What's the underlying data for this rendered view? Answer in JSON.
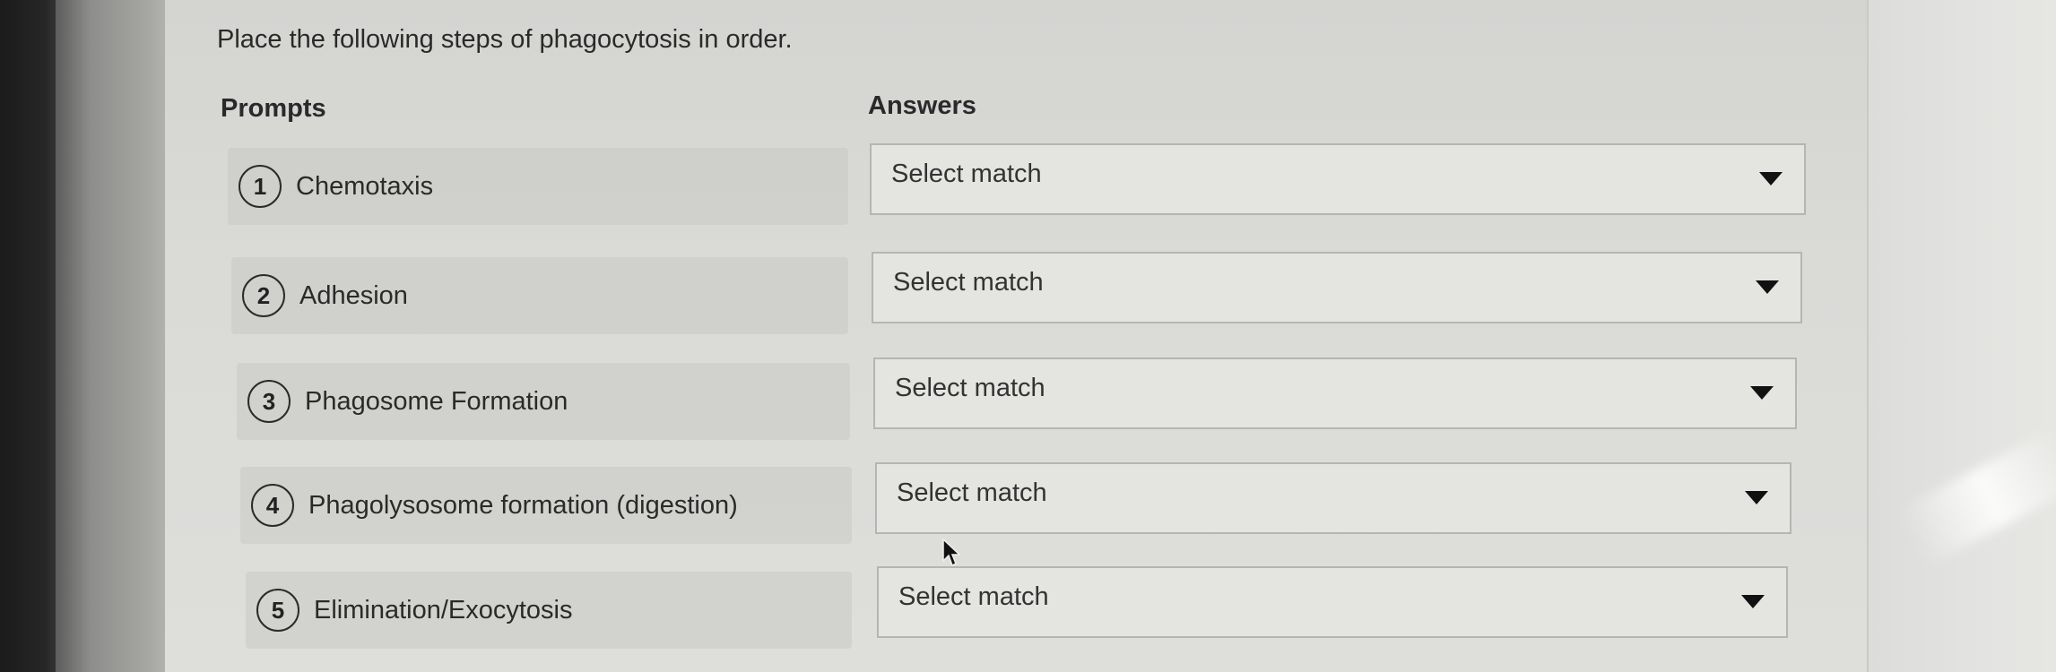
{
  "question": {
    "title": "Place the following steps of phagocytosis in order."
  },
  "columns": {
    "prompts_label": "Prompts",
    "answers_label": "Answers"
  },
  "prompts": [
    {
      "number": "1",
      "text": "Chemotaxis"
    },
    {
      "number": "2",
      "text": "Adhesion"
    },
    {
      "number": "3",
      "text": "Phagosome Formation"
    },
    {
      "number": "4",
      "text": "Phagolysosome formation (digestion)"
    },
    {
      "number": "5",
      "text": "Elimination/Exocytosis"
    }
  ],
  "answers": [
    {
      "selected": "Select match"
    },
    {
      "selected": "Select match"
    },
    {
      "selected": "Select match"
    },
    {
      "selected": "Select match"
    },
    {
      "selected": "Select match"
    }
  ],
  "icons": {
    "dropdown": "chevron-down-icon",
    "pointer": "mouse-cursor-icon"
  }
}
